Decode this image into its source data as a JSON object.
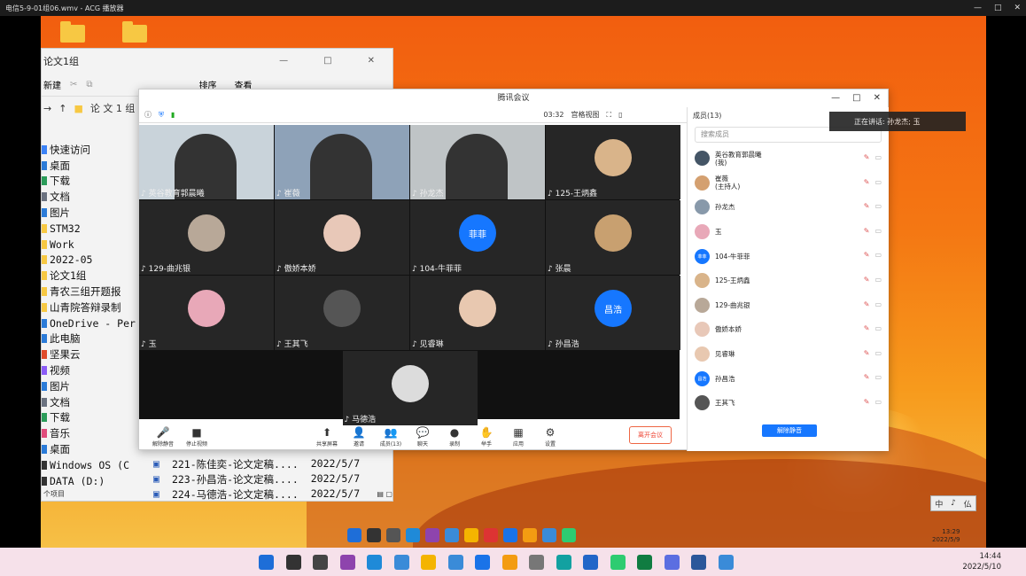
{
  "player": {
    "title": "电信5-9-01组06.wmv - ACG 播放器",
    "min": "—",
    "max": "□",
    "close": "✕"
  },
  "explorer": {
    "title": "论文1组",
    "new_label": "新建",
    "sort_label": "排序",
    "view_label": "查看",
    "address": "论 文 1 组",
    "nav": [
      {
        "label": "快速访问",
        "color": "#3b82f6"
      },
      {
        "label": "桌面",
        "color": "#2b7bd8"
      },
      {
        "label": "下载",
        "color": "#2b9c5a"
      },
      {
        "label": "文档",
        "color": "#6b7280"
      },
      {
        "label": "图片",
        "color": "#2b7bd8"
      },
      {
        "label": "STM32",
        "color": "#f7c843"
      },
      {
        "label": "Work",
        "color": "#f7c843"
      },
      {
        "label": "2022-05",
        "color": "#f7c843"
      },
      {
        "label": "论文1组",
        "color": "#f7c843"
      },
      {
        "label": "青农三组开题报",
        "color": "#f7c843"
      },
      {
        "label": "山青院答辩录制",
        "color": "#f7c843"
      },
      {
        "label": "OneDrive - Per",
        "color": "#2b7bd8"
      },
      {
        "label": "此电脑",
        "color": "#2b7bd8"
      },
      {
        "label": "坚果云",
        "color": "#e04b2b"
      },
      {
        "label": "视频",
        "color": "#8b5cf6"
      },
      {
        "label": "图片",
        "color": "#2b7bd8"
      },
      {
        "label": "文档",
        "color": "#6b7280"
      },
      {
        "label": "下载",
        "color": "#2b9c5a"
      },
      {
        "label": "音乐",
        "color": "#e04b7b"
      },
      {
        "label": "桌面",
        "color": "#2b7bd8"
      },
      {
        "label": "Windows OS (C",
        "color": "#333"
      },
      {
        "label": "DATA (D:)",
        "color": "#333"
      }
    ],
    "files": [
      {
        "name": "221-陈佳奕-论文定稿....",
        "date": "2022/5/7"
      },
      {
        "name": "223-孙昌浩-论文定稿....",
        "date": "2022/5/7"
      },
      {
        "name": "224-马德浩-论文定稿....",
        "date": "2022/5/7"
      }
    ],
    "status": "个项目"
  },
  "meeting": {
    "title": "腾讯会议",
    "timer": "03:32",
    "view_mode": "宫格视图",
    "members_header": "成员(13)",
    "search_placeholder": "搜索成员",
    "tiles": [
      {
        "name": "英谷教育郭晨曦",
        "col": 0,
        "row": 0,
        "kind": "video",
        "bg": "#c9d3da"
      },
      {
        "name": "崔薇",
        "col": 1,
        "row": 0,
        "kind": "video",
        "bg": "#8ea2b8"
      },
      {
        "name": "孙龙杰",
        "col": 2,
        "row": 0,
        "kind": "video",
        "bg": "#bfc4c6"
      },
      {
        "name": "125-王炳鑫",
        "col": 3,
        "row": 0,
        "kind": "avatar",
        "bg": "#d9b48a"
      },
      {
        "name": "129-曲兆银",
        "col": 0,
        "row": 1,
        "kind": "avatar",
        "bg": "#b8a898"
      },
      {
        "name": "傲娇本娇",
        "col": 1,
        "row": 1,
        "kind": "avatar",
        "bg": "#e8c8b8"
      },
      {
        "name": "104-牛菲菲",
        "col": 2,
        "row": 1,
        "kind": "text",
        "bg": "#1677ff",
        "text": "菲菲"
      },
      {
        "name": "张晨",
        "col": 3,
        "row": 1,
        "kind": "avatar",
        "bg": "#c8a070"
      },
      {
        "name": "玉",
        "col": 0,
        "row": 2,
        "kind": "avatar",
        "bg": "#e8a8b8"
      },
      {
        "name": "王其飞",
        "col": 1,
        "row": 2,
        "kind": "avatar",
        "bg": "#555555"
      },
      {
        "name": "见睿琳",
        "col": 2,
        "row": 2,
        "kind": "avatar",
        "bg": "#e8c8b0"
      },
      {
        "name": "孙昌浩",
        "col": 3,
        "row": 2,
        "kind": "text",
        "bg": "#1677ff",
        "text": "昌浩"
      },
      {
        "name": "马德浩",
        "col": 1.5,
        "row": 3,
        "kind": "avatar",
        "bg": "#dcdcdc"
      }
    ],
    "toolbar": [
      {
        "label": "解除静音",
        "glyph": "🎤"
      },
      {
        "label": "停止视频",
        "glyph": "■"
      },
      {
        "label": "共享屏幕",
        "glyph": "⬆"
      },
      {
        "label": "邀请",
        "glyph": "👤"
      },
      {
        "label": "成员(13)",
        "glyph": "👥"
      },
      {
        "label": "聊天",
        "glyph": "💬"
      },
      {
        "label": "录制",
        "glyph": "●"
      },
      {
        "label": "举手",
        "glyph": "✋"
      },
      {
        "label": "应用",
        "glyph": "▦"
      },
      {
        "label": "设置",
        "glyph": "⚙"
      }
    ],
    "leave_label": "离开会议",
    "unmute_all": "解除静音",
    "members": [
      {
        "name": "英谷教育郭晨曦",
        "sub": "(我)",
        "bg": "#445566",
        "mark": ""
      },
      {
        "name": "崔薇",
        "sub": "(主持人)",
        "bg": "#d4a070",
        "mark": ""
      },
      {
        "name": "孙龙杰",
        "sub": "",
        "bg": "#8899aa",
        "mark": ""
      },
      {
        "name": "玉",
        "sub": "",
        "bg": "#e8a8b8",
        "mark": ""
      },
      {
        "name": "104-牛菲菲",
        "sub": "",
        "bg": "#1677ff",
        "mark": "菲菲"
      },
      {
        "name": "125-王炳鑫",
        "sub": "",
        "bg": "#d9b48a",
        "mark": ""
      },
      {
        "name": "129-曲兆银",
        "sub": "",
        "bg": "#b8a898",
        "mark": ""
      },
      {
        "name": "傲娇本娇",
        "sub": "",
        "bg": "#e8c8b8",
        "mark": ""
      },
      {
        "name": "见睿琳",
        "sub": "",
        "bg": "#e8c8b0",
        "mark": ""
      },
      {
        "name": "孙昌浩",
        "sub": "",
        "bg": "#1677ff",
        "mark": "昌浩"
      },
      {
        "name": "王其飞",
        "sub": "",
        "bg": "#555555",
        "mark": ""
      }
    ],
    "speaking": "正在讲话: 孙龙杰; 玉"
  },
  "inner_clock": {
    "time": "13:29",
    "date": "2022/5/9"
  },
  "ime": {
    "a": "中",
    "b": "♪",
    "c": "仏"
  },
  "taskbar": {
    "time": "14:44",
    "date": "2022/5/10"
  }
}
